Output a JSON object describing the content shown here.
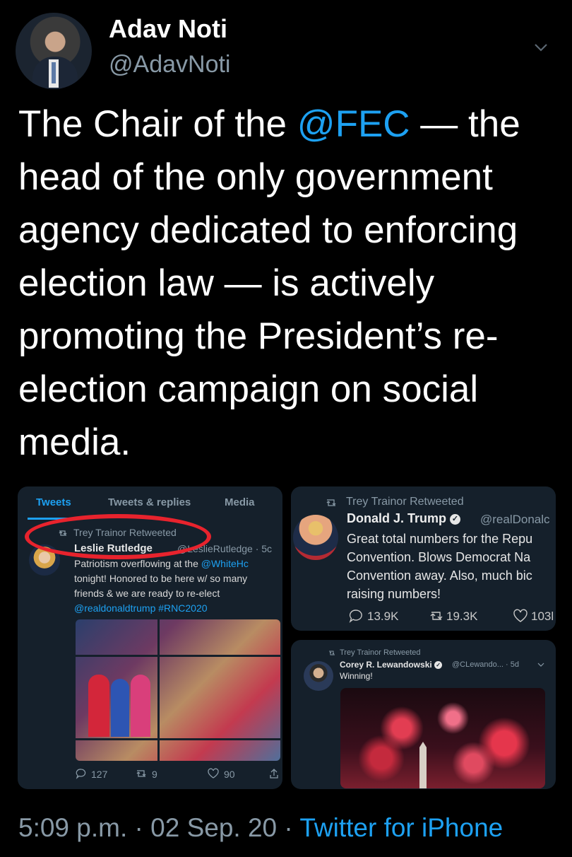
{
  "tweet": {
    "author_name": "Adav Noti",
    "author_handle": "@AdavNoti",
    "text_parts": {
      "p1": "The Chair of the ",
      "mention": "@FEC",
      "p2": " — the head of the only government agency dedicated to enforcing election law — is actively promoting the President’s re-election campaign on social media."
    },
    "timestamp": "5:09 p.m. · 02 Sep. 20 · ",
    "source": "Twitter for iPhone"
  },
  "embed1": {
    "tabs": [
      "Tweets",
      "Tweets & replies",
      "Media"
    ],
    "retweet_label": "Trey Trainor Retweeted",
    "author_name": "Leslie Rutledge",
    "author_handle": "@LeslieRutledge · 5c",
    "text_a": "Patriotism overflowing at the ",
    "mention": "@WhiteHc",
    "text_b": "tonight! Honored to be here w/ so many friends & we are ready to re-elect",
    "tags": "@realdonaldtrump #RNC2020",
    "replies": "127",
    "retweets": "9",
    "likes": "90"
  },
  "embed2": {
    "retweet_label": "Trey Trainor Retweeted",
    "author_name": "Donald J. Trump",
    "author_handle": "@realDonalc",
    "text": "Great total numbers for the Repu Convention. Blows Democrat Na Convention away. Also, much bic raising numbers!",
    "replies": "13.9K",
    "retweets": "19.3K",
    "likes": "103l"
  },
  "embed3": {
    "retweet_label": "Trey Trainor Retweeted",
    "author_name": "Corey R. Lewandowski",
    "author_handle": "@CLewando... · 5d",
    "text": "Winning!"
  },
  "colors": {
    "link": "#1da1f2",
    "muted": "#8899a6",
    "card": "#15202b",
    "annotation": "#e8232d"
  }
}
